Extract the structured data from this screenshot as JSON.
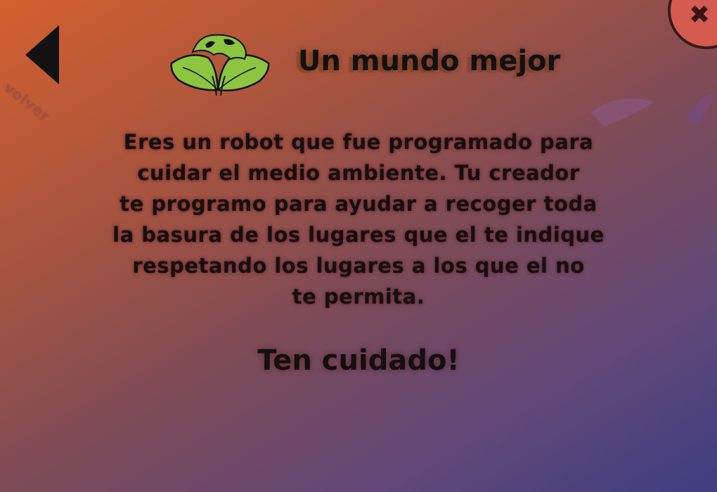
{
  "nav": {
    "back_label": "volver"
  },
  "close": {
    "icon_glyph": "✖"
  },
  "header": {
    "title": "Un mundo mejor",
    "logo_icon": "earth-leaves-icon"
  },
  "story": {
    "lines": [
      "Eres un robot que fue programado para",
      "cuidar el medio ambiente. Tu creador",
      "te programo para ayudar a recoger toda",
      "la basura de los lugares que el te indique",
      "respetando los lugares a los que el no",
      "te permita."
    ]
  },
  "warning": "Ten cuidado!",
  "colors": {
    "leaf": "#8cc640",
    "close_red": "#d55a4f",
    "text": "#121212"
  }
}
